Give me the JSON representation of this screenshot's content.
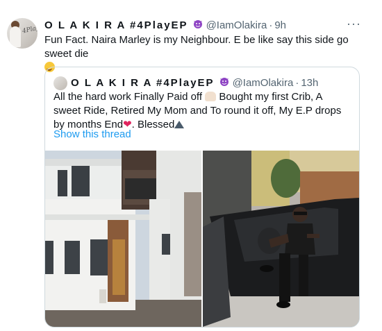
{
  "tweet": {
    "author_name": "O L A K I R A #4PlayEP",
    "author_emoji": "devil-face-emoji",
    "handle": "@IamOlakira",
    "separator": "·",
    "time": "9h",
    "more_label": "···",
    "text": "Fun Fact. Naira Marley is my Neighbour. E be like say this side go sweet die",
    "avatar_signature": "4Play"
  },
  "quoted": {
    "author_name": "O L A K I R A #4PlayEP",
    "handle": "@IamOlakira",
    "separator": "·",
    "time": "13h",
    "text_part1": "All the hard work Finally Paid off",
    "text_part2": " Bought my first Crib, A sweet Ride, Retired My Mom and To round it off, My E.P drops by months End",
    "text_part3": ". Blessed",
    "show_thread": "Show this thread"
  },
  "colors": {
    "link": "#1d9bf0",
    "secondary_text": "#536471",
    "border": "#cfd9de",
    "heart": "#e0245e"
  }
}
